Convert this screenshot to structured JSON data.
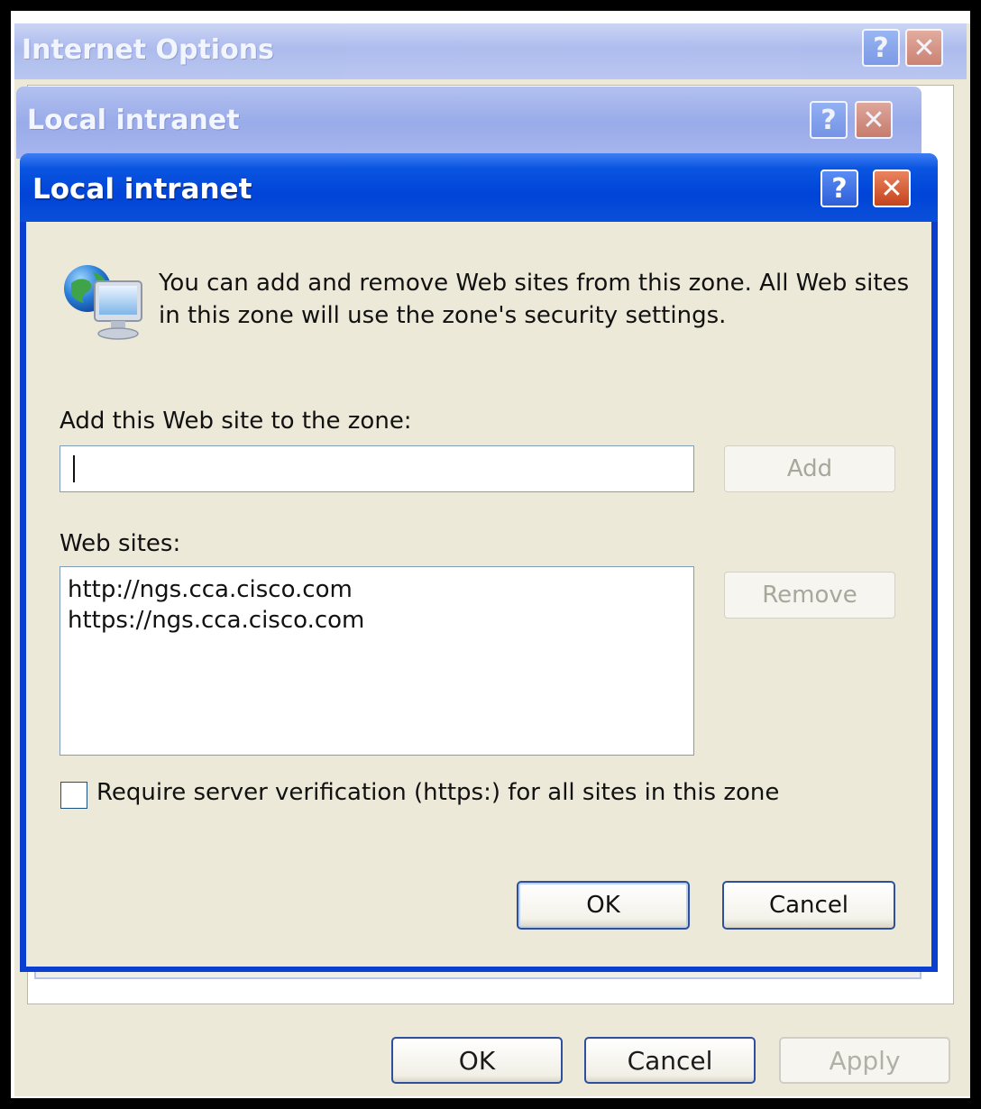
{
  "internet_options": {
    "title": "Internet Options",
    "help_glyph": "?",
    "close_glyph": "✕",
    "ok_label": "OK",
    "cancel_label": "Cancel",
    "apply_label": "Apply"
  },
  "local_intranet_back": {
    "title": "Local intranet",
    "help_glyph": "?",
    "close_glyph": "✕"
  },
  "local_intranet_dialog": {
    "title": "Local intranet",
    "help_glyph": "?",
    "close_glyph": "✕",
    "info_icon": "globe-monitor-icon",
    "info_line1": "You can add and remove Web sites from this zone. All Web sites",
    "info_line2": "in this zone will use the zone's security settings.",
    "add_label": "Add this Web site to the zone:",
    "add_input_value": "",
    "add_button": "Add",
    "web_sites_label": "Web sites:",
    "web_sites": [
      "http://ngs.cca.cisco.com",
      "https://ngs.cca.cisco.com"
    ],
    "remove_button": "Remove",
    "require_verification_label": "Require server verification (https:) for all sites in this zone",
    "require_verification_checked": false,
    "ok_label": "OK",
    "cancel_label": "Cancel"
  },
  "colors": {
    "title_bar_active": "#0044d8",
    "dialog_face": "#ece9d8",
    "close_button": "#c5431c",
    "help_button": "#2f5fd8"
  }
}
